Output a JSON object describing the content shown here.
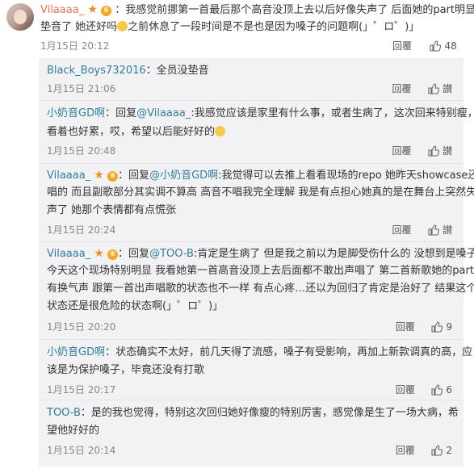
{
  "main_comment": {
    "user": "Vilaaaa_",
    "text_line1": "：我感觉前挪第一首最后那个高音没顶上去以后好像失声了 后面她的part明显只有",
    "text_line2a": "垫音了 她还好吗",
    "text_line2b": "之前休息了一段时间是不是也是因为嗓子的问题啊(」゜ロ゜)」",
    "date": "1月15日 20:12",
    "reply_label": "回覆",
    "likes": "48"
  },
  "replies": [
    {
      "user": "Black_Boys732016",
      "text": "：全员没垫音",
      "date": "1月15日 21:06",
      "reply_label": "回覆",
      "like_label": "讃",
      "likes": ""
    },
    {
      "user": "小奶音GD啊",
      "prefix": "：回复",
      "mention": "@Vilaaaa_",
      "text_line1": ":我感觉应该是家里有什么事，或者生病了，这次回来特别瘦，",
      "text_line2": "看着也好累，哎，希望以后能好好的",
      "date": "1月15日 20:48",
      "reply_label": "回覆",
      "like_label": "讃",
      "likes": ""
    },
    {
      "user": "Vilaaaa_",
      "prefix": "：回复",
      "mention": "@小奶音GD啊",
      "text_line1": ":我觉得可以去推上看看现场的repo 她昨天showcase还有",
      "text_line2": "唱的 而且副歌部分其实调不算高 高音不唱我完全理解 我是有点担心她真的是在舞台上突然失",
      "text_line3": "声了 她那个表情都有点慌张",
      "date": "1月15日 20:24",
      "reply_label": "回覆",
      "like_label": "讃",
      "likes": ""
    },
    {
      "user": "Vilaaaa_",
      "prefix": "：回复",
      "mention": "@TOO-B",
      "text_line1": ":肯定是生病了 但是我之前以为是脚受伤什么的 没想到是嗓子",
      "text_line2": "今天这个现场特别明显 我看她第一首高音没顶上去后面都不敢出声唱了 第二首新歌她的part没",
      "text_line3": "有换气声 跟第一首出声唱歌的状态也不一样 有点心疼…还以为回归了肯定是治好了 结果这个",
      "text_line4": "状态还是很危险的状态啊(」゜ロ゜)」",
      "date": "1月15日 20:20",
      "reply_label": "回覆",
      "likes": "9"
    },
    {
      "user": "小奶音GD啊",
      "text_line1": "：状态确实不太好，前几天得了流感，嗓子有受影响，再加上新款调真的高，应",
      "text_line2": "该是为保护嗓子，毕竟还没有打歌",
      "date": "1月15日 20:17",
      "reply_label": "回覆",
      "likes": "6"
    },
    {
      "user": "TOO-B",
      "text_line1": "：是的我也觉得，特别这次回归她好像瘦的特别厉害，感觉像是生了一场大病，希",
      "text_line2": "望他好好的",
      "date": "1月15日 20:14",
      "reply_label": "回覆",
      "likes": "2"
    }
  ],
  "colors": {
    "username_orange": "#eb7350",
    "username_blue": "#2f7d9e",
    "reply_bg": "#f2f2f5"
  }
}
